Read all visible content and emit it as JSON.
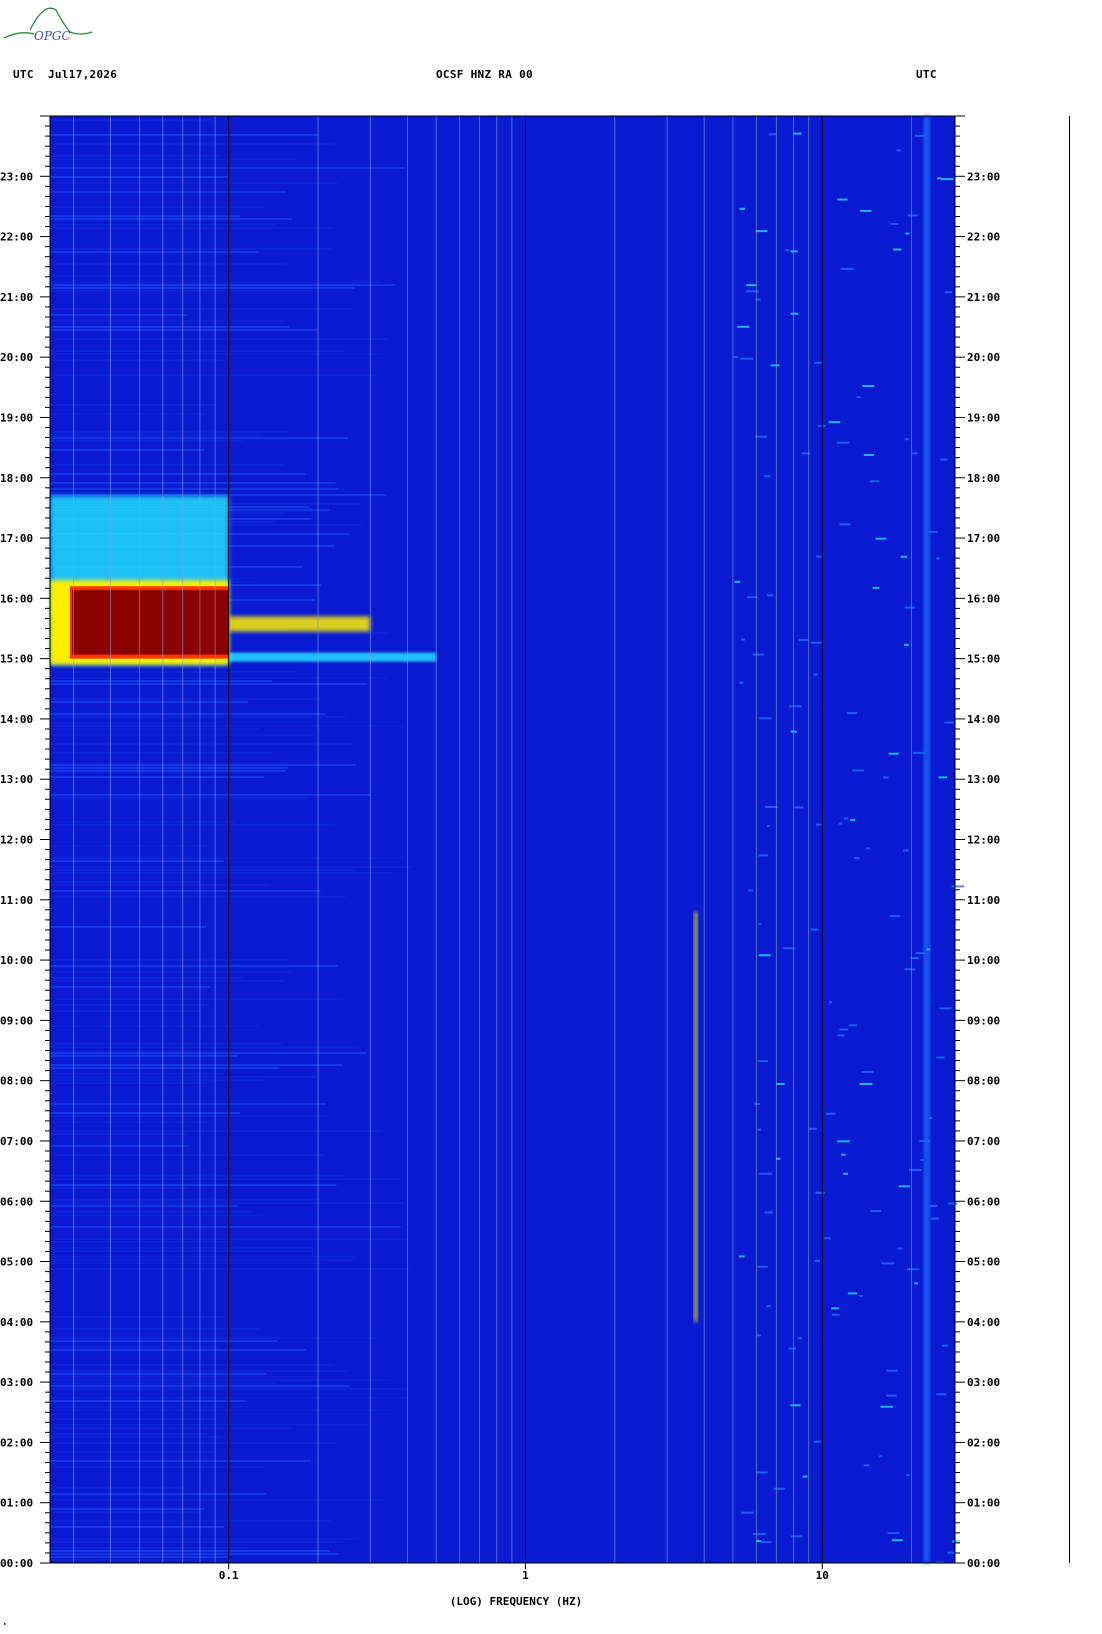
{
  "header": {
    "left_label": "UTC",
    "date": "Jul17,2026",
    "station": "OCSF HNZ RA 00",
    "right_label": "UTC",
    "logo_text": "OPGC"
  },
  "chart_data": {
    "type": "heatmap",
    "title": "OCSF HNZ RA 00",
    "xlabel": "(LOG) FREQUENCY (HZ)",
    "x_scale": "log",
    "xlim": [
      0.025,
      28
    ],
    "x_major_ticks": [
      {
        "value": 0.1,
        "label": "0.1"
      },
      {
        "value": 1,
        "label": "1"
      },
      {
        "value": 10,
        "label": "10"
      }
    ],
    "x_minor_gridlines": [
      0.03,
      0.04,
      0.05,
      0.06,
      0.07,
      0.08,
      0.09,
      0.2,
      0.3,
      0.4,
      0.5,
      0.6,
      0.7,
      0.8,
      0.9,
      2,
      3,
      4,
      5,
      6,
      7,
      8,
      9,
      20
    ],
    "ylabel": "UTC",
    "ylim_hours": [
      0,
      24
    ],
    "y_ticks": [
      "00:00",
      "01:00",
      "02:00",
      "03:00",
      "04:00",
      "05:00",
      "06:00",
      "07:00",
      "08:00",
      "09:00",
      "10:00",
      "11:00",
      "12:00",
      "13:00",
      "14:00",
      "15:00",
      "16:00",
      "17:00",
      "18:00",
      "19:00",
      "20:00",
      "21:00",
      "22:00",
      "23:00"
    ],
    "colormap": [
      "#0000aa",
      "#0a2ae0",
      "#1e70ff",
      "#22ddff",
      "#ffee00",
      "#ff3300",
      "#8b0000"
    ],
    "background_color": "#0a1ad0",
    "events": [
      {
        "name": "",
        "t_start": 15.0,
        "t_end": 16.2,
        "f_min": 0.025,
        "f_max": 0.1,
        "intensity": 1.0
      },
      {
        "name": "",
        "t_start": 14.9,
        "t_end": 17.7,
        "f_min": 0.025,
        "f_max": 0.1,
        "intensity": 0.45
      },
      {
        "name": "",
        "t_start": 15.45,
        "t_end": 15.7,
        "f_min": 0.1,
        "f_max": 0.3,
        "intensity": 0.7
      },
      {
        "name": "",
        "t_start": 14.95,
        "t_end": 15.1,
        "f_min": 0.1,
        "f_max": 0.5,
        "intensity": 0.5
      },
      {
        "name": "",
        "t_start": 4.0,
        "t_end": 10.8,
        "f_min": 3.7,
        "f_max": 3.8,
        "intensity": 0.6
      },
      {
        "name": "",
        "t_start": 0.0,
        "t_end": 24.0,
        "f_min": 22.0,
        "f_max": 23.0,
        "intensity": 0.4
      }
    ]
  }
}
